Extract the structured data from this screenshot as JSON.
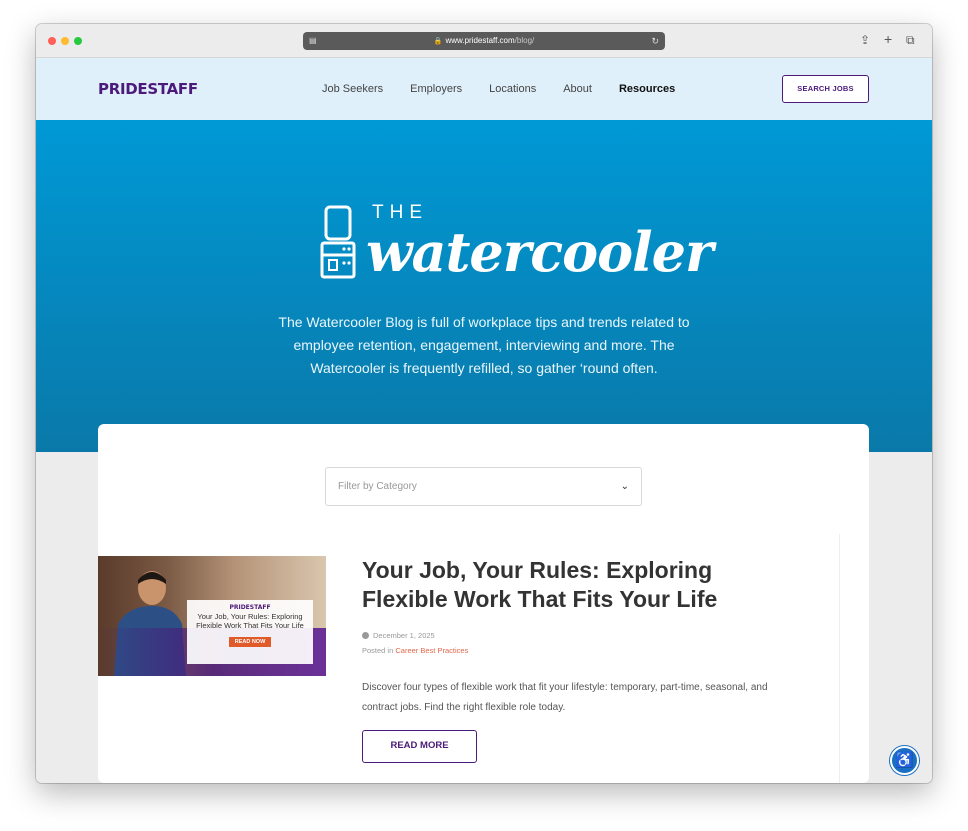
{
  "browser": {
    "url_domain": "www.pridestaff.com",
    "url_path": "/blog/"
  },
  "nav": {
    "logo": "PRIDESTAFF",
    "links": [
      "Job Seekers",
      "Employers",
      "Locations",
      "About",
      "Resources"
    ],
    "active": "Resources",
    "search_button": "SEARCH JOBS"
  },
  "hero": {
    "title_small": "THE",
    "title_script": "watercooler",
    "intro": "The Watercooler Blog is full of workplace tips and trends related to employee retention, engagement, interviewing and more. The Watercooler is frequently refilled, so gather ‘round often."
  },
  "filter": {
    "placeholder": "Filter by Category"
  },
  "post": {
    "title": "Your Job, Your Rules: Exploring Flexible Work That Fits Your Life",
    "date": "December 1, 2025",
    "posted_in_label": "Posted in",
    "category": "Career Best Practices",
    "excerpt": "Discover four types of flexible work that fit your lifestyle: temporary, part-time, seasonal, and contract jobs. Find the right flexible role today.",
    "read_more": "READ MORE",
    "thumb": {
      "brand": "PRIDESTAFF",
      "title": "Your Job, Your Rules: Exploring Flexible Work That Fits Your Life",
      "cta": "READ NOW"
    }
  },
  "icons": {
    "lock": "lock-icon",
    "reload": "reload-icon",
    "share": "share-icon",
    "new_tab": "plus-icon",
    "tabs": "tabs-icon",
    "accessibility": "accessibility-icon",
    "cooler": "water-cooler-icon"
  }
}
